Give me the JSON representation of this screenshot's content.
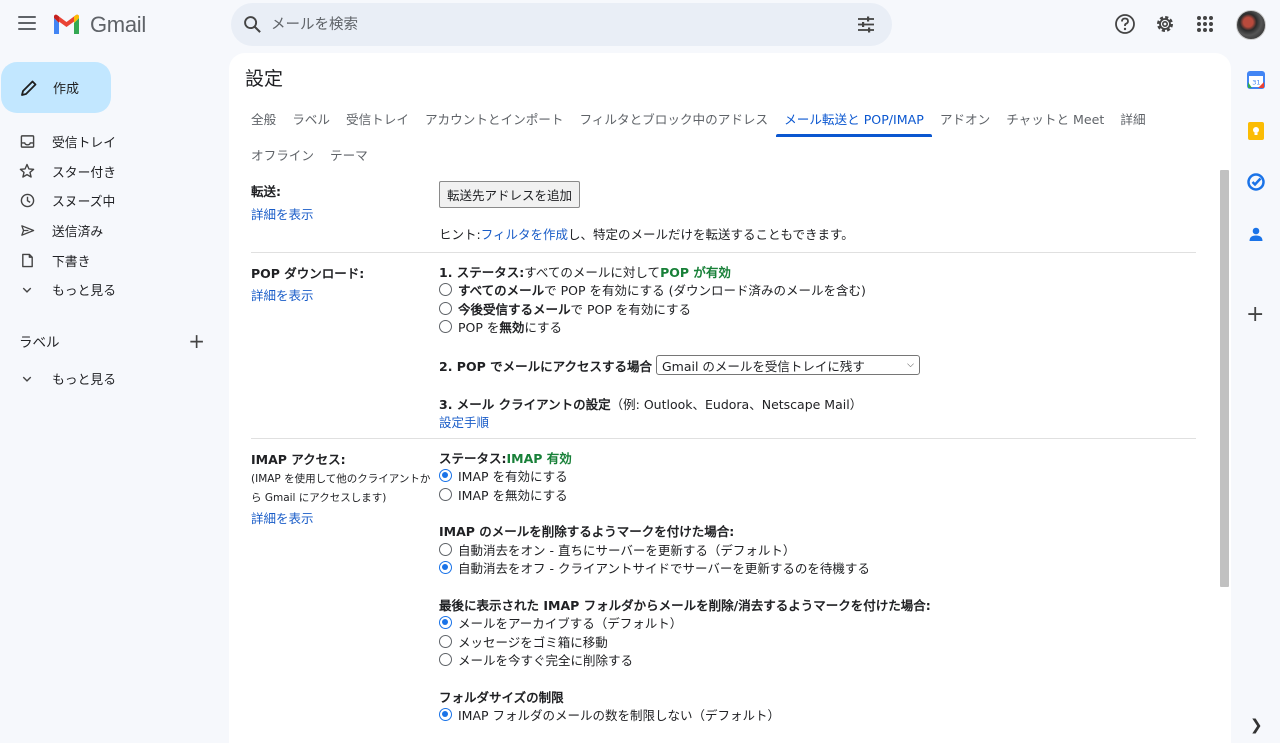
{
  "app": {
    "logo_text": "Gmail"
  },
  "search": {
    "placeholder": "メールを検索"
  },
  "compose": {
    "label": "作成"
  },
  "nav": {
    "items": [
      {
        "label": "受信トレイ",
        "icon": "inbox-icon"
      },
      {
        "label": "スター付き",
        "icon": "star-icon"
      },
      {
        "label": "スヌーズ中",
        "icon": "clock-icon"
      },
      {
        "label": "送信済み",
        "icon": "send-icon"
      },
      {
        "label": "下書き",
        "icon": "draft-icon"
      },
      {
        "label": "もっと見る",
        "icon": "chevron-down-icon"
      }
    ],
    "labels_title": "ラベル",
    "labels_more": "もっと見る"
  },
  "settings": {
    "title": "設定",
    "tabs_row1": [
      "全般",
      "ラベル",
      "受信トレイ",
      "アカウントとインポート",
      "フィルタとブロック中のアドレス",
      "メール転送と POP/IMAP",
      "アドオン",
      "チャットと Meet",
      "詳細"
    ],
    "tabs_row2": [
      "オフライン",
      "テーマ"
    ],
    "active_tab": "メール転送と POP/IMAP",
    "forwarding": {
      "label": "転送:",
      "details_link": "詳細を表示",
      "add_button": "転送先アドレスを追加",
      "hint_prefix": "ヒント: ",
      "hint_link": "フィルタを作成",
      "hint_suffix": "し、特定のメールだけを転送することもできます。"
    },
    "pop": {
      "label": "POP ダウンロード:",
      "details_link": "詳細を表示",
      "status_prefix": "1. ステータス:",
      "status_text": " すべてのメールに対して ",
      "status_value": "POP が有効",
      "options": [
        {
          "bold": "すべてのメール",
          "rest": "で POP を有効にする (ダウンロード済みのメールを含む)"
        },
        {
          "bold": "今後受信するメール",
          "rest": "で POP を有効にする"
        },
        {
          "pre": "POP を ",
          "bold": "無効",
          "rest": "にする"
        }
      ],
      "access_label": "2. POP でメールにアクセスする場合",
      "access_select": "Gmail のメールを受信トレイに残す",
      "client_label": "3. メール クライアントの設定",
      "client_examples": "（例: Outlook、Eudora、Netscape Mail）",
      "client_link": "設定手順"
    },
    "imap": {
      "label": "IMAP アクセス:",
      "note_line1": "(IMAP を使用して他のクライアントか",
      "note_line2": "ら Gmail にアクセスします)",
      "details_link": "詳細を表示",
      "status_prefix": "ステータス: ",
      "status_value": "IMAP 有効",
      "enable_options": [
        "IMAP を有効にする",
        "IMAP を無効にする"
      ],
      "delete_heading": "IMAP のメールを削除するようマークを付けた場合:",
      "delete_options": [
        "自動消去をオン - 直ちにサーバーを更新する（デフォルト）",
        "自動消去をオフ - クライアントサイドでサーバーを更新するのを待機する"
      ],
      "expunge_heading": "最後に表示された IMAP フォルダからメールを削除/消去するようマークを付けた場合:",
      "expunge_options": [
        "メールをアーカイブする（デフォルト）",
        "メッセージをゴミ箱に移動",
        "メールを今すぐ完全に削除する"
      ],
      "folder_heading": "フォルダサイズの制限",
      "folder_option": "IMAP フォルダのメールの数を制限しない（デフォルト）"
    }
  },
  "colors": {
    "accent": "#0b57d0",
    "compose_bg": "#c2e7ff",
    "status_green": "#188038",
    "link": "#1a5dc8"
  }
}
